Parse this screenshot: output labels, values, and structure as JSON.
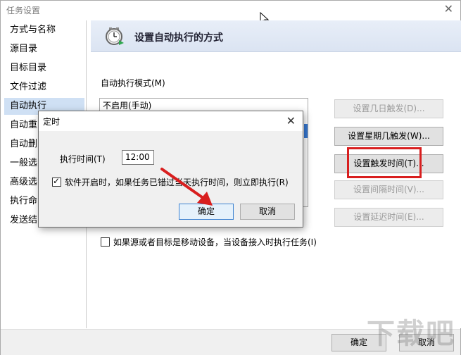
{
  "window": {
    "title": "任务设置",
    "close_glyph": "✕"
  },
  "sidebar": {
    "items": [
      {
        "label": "方式与名称"
      },
      {
        "label": "源目录"
      },
      {
        "label": "目标目录"
      },
      {
        "label": "文件过滤"
      },
      {
        "label": "自动执行",
        "selected": true
      },
      {
        "label": "自动重"
      },
      {
        "label": "自动删"
      },
      {
        "label": "一般选"
      },
      {
        "label": "高级选"
      },
      {
        "label": "执行命"
      },
      {
        "label": "发送结"
      }
    ]
  },
  "content": {
    "header_title": "设置自动执行的方式",
    "header_icon": "clock-icon",
    "mode_label": "自动执行模式(M)",
    "mode_list": [
      "不启用(手动)"
    ],
    "buttons": {
      "days": "设置几日触发(D)...",
      "weekdays": "设置星期几触发(W)...",
      "trigger_time": "设置触发时间(T)...",
      "interval": "设置间隔时间(V)...",
      "delay": "设置延迟时间(E)..."
    },
    "mobile_checkbox": "如果源或者目标是移动设备，当设备接入时执行任务(I)"
  },
  "footer": {
    "ok": "确定",
    "cancel": "取消"
  },
  "dialog": {
    "title": "定时",
    "time_label": "执行时间(T)",
    "time_value": "12:00",
    "startup_check": "软件开启时，如果任务已错过当天执行时间，则立即执行(R)",
    "ok": "确定",
    "cancel": "取消"
  },
  "colors": {
    "selection": "#3679d4",
    "highlight_box": "#d81e1e",
    "arrow": "#d81e1e"
  }
}
